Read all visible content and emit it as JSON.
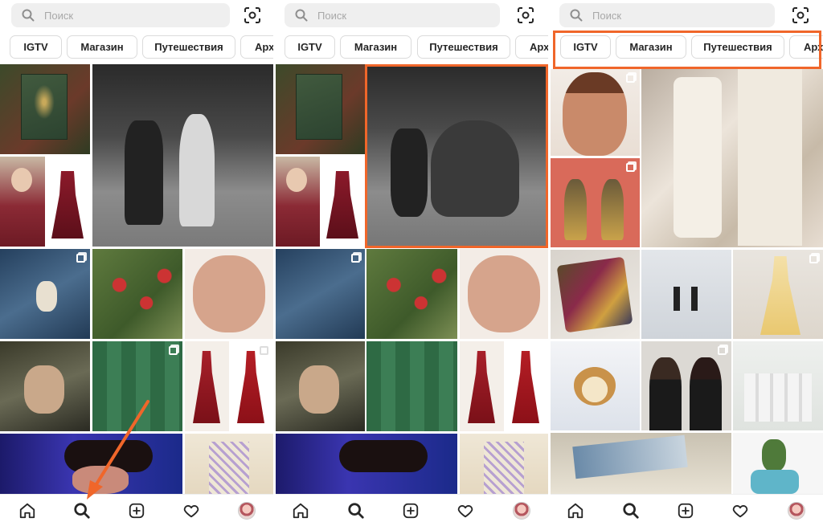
{
  "search": {
    "placeholder": "Поиск"
  },
  "chips": [
    "IGTV",
    "Магазин",
    "Путешествия",
    "Архи"
  ],
  "accent_color": "#f0662a",
  "icons": {
    "search": "search-icon",
    "scan": "qr-scan-icon",
    "home": "home-icon",
    "explore": "search-icon",
    "new_post": "plus-square-icon",
    "activity": "heart-icon",
    "profile": "avatar"
  },
  "screens": [
    {
      "label": "step-1"
    },
    {
      "label": "step-2"
    },
    {
      "label": "step-3"
    }
  ]
}
